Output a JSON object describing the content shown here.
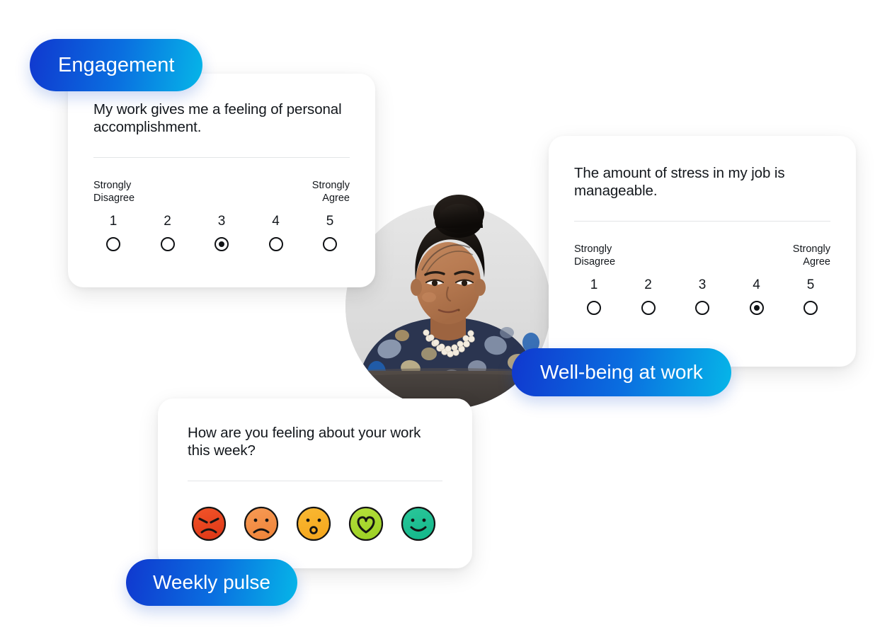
{
  "badges": {
    "engagement": "Engagement",
    "wellbeing": "Well-being at work",
    "pulse": "Weekly pulse"
  },
  "colors": {
    "gradient_start": "#1038cf",
    "gradient_mid": "#0a6fe0",
    "gradient_end": "#06b6e8",
    "card_background": "#ffffff",
    "text": "#13171c",
    "divider": "#e3e5e7",
    "radio_border": "#101215"
  },
  "cards": [
    {
      "id": "engagement",
      "question": "My work gives me a feeling of personal accomplishment.",
      "anchor_low": "Strongly\nDisagree",
      "anchor_low_line1": "Strongly",
      "anchor_low_line2": "Disagree",
      "anchor_high_line1": "Strongly",
      "anchor_high_line2": "Agree",
      "scale": [
        "1",
        "2",
        "3",
        "4",
        "5"
      ],
      "selected": 3
    },
    {
      "id": "wellbeing",
      "question": "The amount of stress in my job is manageable.",
      "anchor_low_line1": "Strongly",
      "anchor_low_line2": "Disagree",
      "anchor_high_line1": "Strongly",
      "anchor_high_line2": "Agree",
      "scale": [
        "1",
        "2",
        "3",
        "4",
        "5"
      ],
      "selected": 4
    },
    {
      "id": "pulse",
      "question": "How are you feeling about your work this week?",
      "selected": null,
      "emoji_options": [
        {
          "name": "angry-face",
          "label": "Angry",
          "color_top": "#f2552a",
          "color_bottom": "#e03a18"
        },
        {
          "name": "sad-face",
          "label": "Sad",
          "color_top": "#f79b55",
          "color_bottom": "#f0863c"
        },
        {
          "name": "surprised-face",
          "label": "Surprised",
          "color_top": "#f9b933",
          "color_bottom": "#f5a81f"
        },
        {
          "name": "love-face",
          "label": "Love",
          "color_top": "#b5e03c",
          "color_bottom": "#9ed126"
        },
        {
          "name": "happy-face",
          "label": "Happy",
          "color_top": "#2bc79a",
          "color_bottom": "#16b98c"
        }
      ]
    }
  ],
  "photo": {
    "name": "woman-at-laptop-photo",
    "description": "Woman working at a laptop"
  }
}
